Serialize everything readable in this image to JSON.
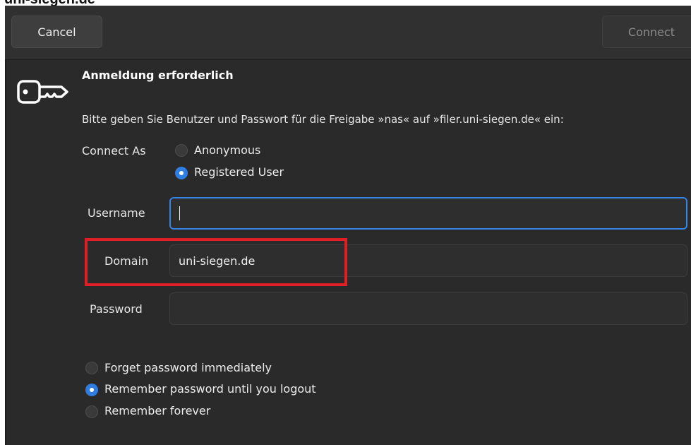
{
  "page": {
    "caption": "uni-siegen.de"
  },
  "header": {
    "cancel_label": "Cancel",
    "connect_label": "Connect"
  },
  "icon": {
    "name": "key-icon"
  },
  "auth": {
    "title": "Anmeldung erforderlich",
    "message": "Bitte geben Sie Benutzer und Passwort für die Freigabe »nas« auf »filer.uni-siegen.de« ein:"
  },
  "connect_as": {
    "label": "Connect As",
    "options": [
      {
        "label": "Anonymous",
        "selected": false
      },
      {
        "label": "Registered User",
        "selected": true
      }
    ]
  },
  "fields": {
    "username": {
      "label": "Username",
      "value": ""
    },
    "domain": {
      "label": "Domain",
      "value": "uni-siegen.de"
    },
    "password": {
      "label": "Password",
      "value": ""
    }
  },
  "remember": {
    "options": [
      {
        "label": "Forget password immediately",
        "selected": false
      },
      {
        "label": "Remember password until you logout",
        "selected": true
      },
      {
        "label": "Remember forever",
        "selected": false
      }
    ]
  },
  "colors": {
    "accent": "#3584e4",
    "radio_checked": "#2f7de1",
    "dialog_bg": "#2a2a2a",
    "highlight": "#e01e26"
  }
}
